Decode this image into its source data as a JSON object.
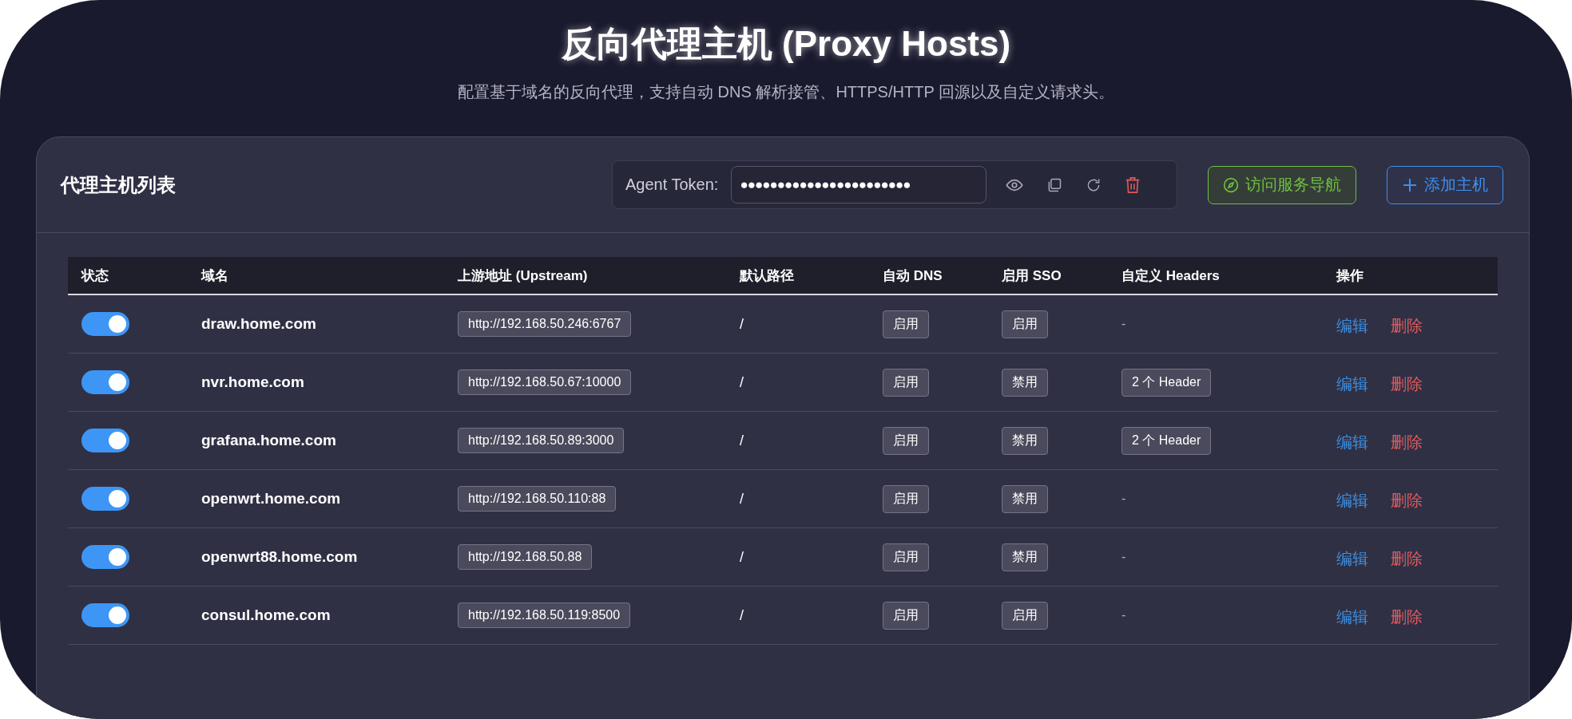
{
  "page": {
    "title": "反向代理主机 (Proxy Hosts)",
    "subtitle": "配置基于域名的反向代理，支持自动 DNS 解析接管、HTTPS/HTTP 回源以及自定义请求头。"
  },
  "card": {
    "title": "代理主机列表",
    "token": {
      "label": "Agent Token:",
      "value": "●●●●●●●●●●●●●●●●●●●●●●●"
    },
    "buttons": [
      {
        "label": "访问服务导航",
        "kind": "nav"
      },
      {
        "label": "添加主机",
        "kind": "add"
      }
    ]
  },
  "table": {
    "columns": [
      "状态",
      "域名",
      "上游地址 (Upstream)",
      "默认路径",
      "自动 DNS",
      "启用 SSO",
      "自定义 Headers",
      "操作"
    ],
    "rows": [
      {
        "on": true,
        "domain": "draw.home.com",
        "upstream": "http://192.168.50.246:6767",
        "path": "/",
        "auto_dns": "启用",
        "sso": "启用",
        "headers": {
          "kind": "none",
          "text": "-"
        },
        "actions": [
          {
            "label": "编辑",
            "kind": "edit"
          },
          {
            "label": "删除",
            "kind": "delete"
          }
        ]
      },
      {
        "on": true,
        "domain": "nvr.home.com",
        "upstream": "http://192.168.50.67:10000",
        "path": "/",
        "auto_dns": "启用",
        "sso": "禁用",
        "headers": {
          "kind": "badge",
          "text": "2 个 Header"
        },
        "actions": [
          {
            "label": "编辑",
            "kind": "edit"
          },
          {
            "label": "删除",
            "kind": "delete"
          }
        ]
      },
      {
        "on": true,
        "domain": "grafana.home.com",
        "upstream": "http://192.168.50.89:3000",
        "path": "/",
        "auto_dns": "启用",
        "sso": "禁用",
        "headers": {
          "kind": "badge",
          "text": "2 个 Header"
        },
        "actions": [
          {
            "label": "编辑",
            "kind": "edit"
          },
          {
            "label": "删除",
            "kind": "delete"
          }
        ]
      },
      {
        "on": true,
        "domain": "openwrt.home.com",
        "upstream": "http://192.168.50.110:88",
        "path": "/",
        "auto_dns": "启用",
        "sso": "禁用",
        "headers": {
          "kind": "none",
          "text": "-"
        },
        "actions": [
          {
            "label": "编辑",
            "kind": "edit"
          },
          {
            "label": "删除",
            "kind": "delete"
          }
        ]
      },
      {
        "on": true,
        "domain": "openwrt88.home.com",
        "upstream": "http://192.168.50.88",
        "path": "/",
        "auto_dns": "启用",
        "sso": "禁用",
        "headers": {
          "kind": "none",
          "text": "-"
        },
        "actions": [
          {
            "label": "编辑",
            "kind": "edit"
          },
          {
            "label": "删除",
            "kind": "delete"
          }
        ]
      },
      {
        "on": true,
        "domain": "consul.home.com",
        "upstream": "http://192.168.50.119:8500",
        "path": "/",
        "auto_dns": "启用",
        "sso": "启用",
        "headers": {
          "kind": "none",
          "text": "-"
        },
        "actions": [
          {
            "label": "编辑",
            "kind": "edit"
          },
          {
            "label": "删除",
            "kind": "delete"
          }
        ]
      }
    ]
  }
}
